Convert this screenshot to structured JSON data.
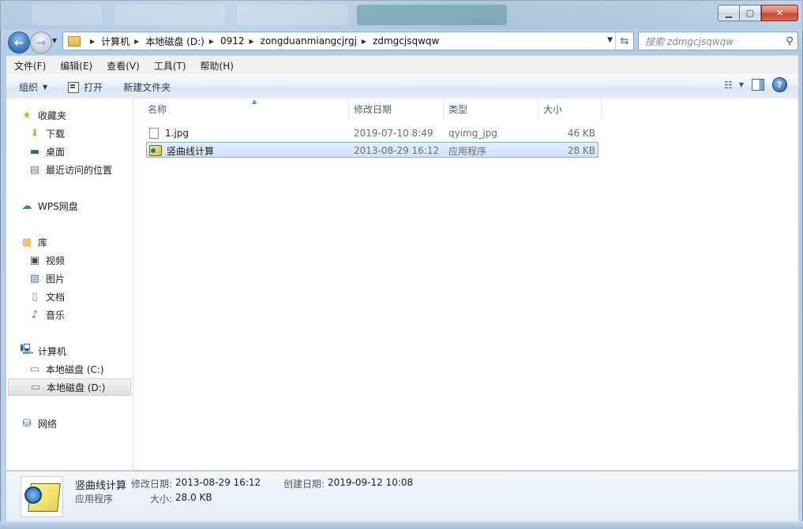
{
  "window": {
    "caption_buttons": {
      "minimize": "▁",
      "maximize": "▢",
      "close": "✕"
    }
  },
  "address": {
    "crumbs": [
      "计算机",
      "本地磁盘 (D:)",
      "0912",
      "zongduanmiangcjrgj",
      "zdmgcjsqwqw"
    ],
    "refresh_glyph": "⇆"
  },
  "search": {
    "placeholder": "搜索 zdmgcjsqwqw",
    "icon": "magnifier-icon"
  },
  "menu": [
    "文件(F)",
    "编辑(E)",
    "查看(V)",
    "工具(T)",
    "帮助(H)"
  ],
  "toolbar": {
    "organize": "组织",
    "open": "打开",
    "new_folder": "新建文件夹"
  },
  "sidebar": {
    "favorites": "收藏夹",
    "downloads": "下载",
    "desktop": "桌面",
    "recent": "最近访问的位置",
    "wps": "WPS网盘",
    "libraries": "库",
    "videos": "视频",
    "pictures": "图片",
    "documents": "文档",
    "music": "音乐",
    "computer": "计算机",
    "drive_c": "本地磁盘 (C:)",
    "drive_d": "本地磁盘 (D:)",
    "network": "网络"
  },
  "columns": {
    "name": "名称",
    "modified": "修改日期",
    "type": "类型",
    "size": "大小"
  },
  "files": [
    {
      "name": "1.jpg",
      "modified": "2019-07-10 8:49",
      "type": "qyimg_jpg",
      "size": "46 KB"
    },
    {
      "name": "竖曲线计算",
      "modified": "2013-08-29 16:12",
      "type": "应用程序",
      "size": "28 KB"
    }
  ],
  "details": {
    "name": "竖曲线计算",
    "kind": "应用程序",
    "modified_label": "修改日期:",
    "modified": "2013-08-29 16:12",
    "created_label": "创建日期:",
    "created": "2019-09-12 10:08",
    "size_label": "大小:",
    "size": "28.0 KB"
  }
}
